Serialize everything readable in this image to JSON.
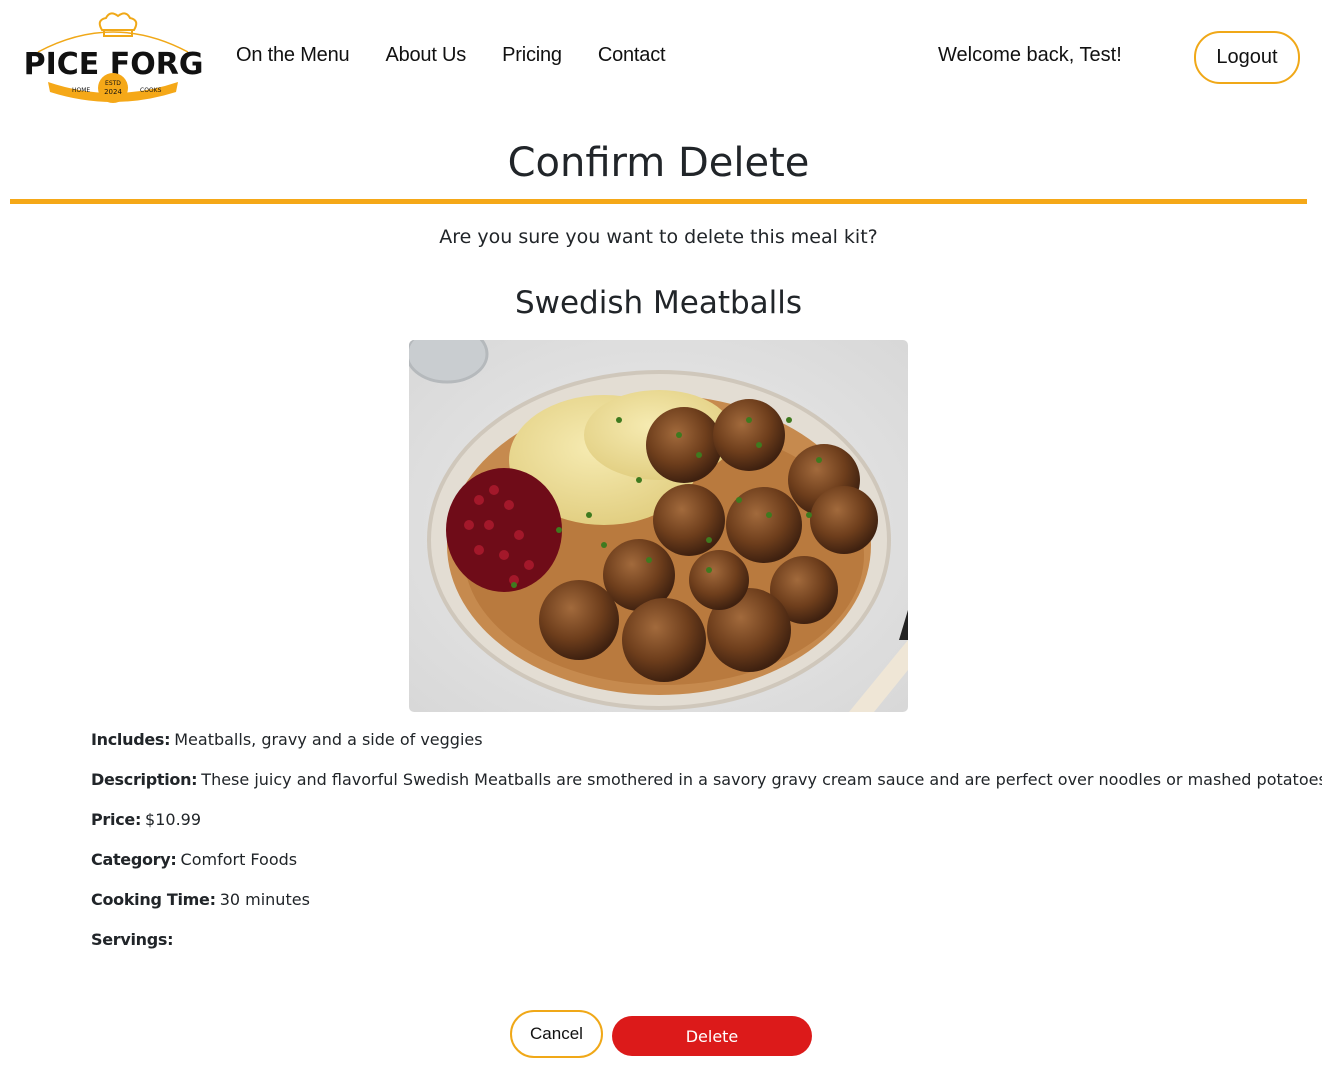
{
  "colors": {
    "accent": "#f5a818",
    "danger": "#dc1a1a",
    "text": "#212529"
  },
  "header": {
    "logo": {
      "icon": "chef-hat-logo",
      "brand": "SPICE FORGE",
      "left_tag": "HOME",
      "right_tag": "COOKS",
      "estd": "ESTD",
      "year": "2024"
    },
    "nav": [
      "On the Menu",
      "About Us",
      "Pricing",
      "Contact"
    ],
    "welcome": "Welcome back, Test!",
    "logout_label": "Logout"
  },
  "main": {
    "title": "Confirm Delete",
    "prompt": "Are you sure you want to delete this meal kit?",
    "meal_kit": {
      "name": "Swedish Meatballs",
      "image": "swedish-meatballs-photo",
      "includes_label": "Includes:",
      "includes": "Meatballs, gravy and a side of veggies",
      "description_label": "Description:",
      "description": "These juicy and flavorful Swedish Meatballs are smothered in a savory gravy cream sauce and are perfect over noodles or mashed potatoes.",
      "price_label": "Price:",
      "price": "$10.99",
      "category_label": "Category:",
      "category": "Comfort Foods",
      "cooking_time_label": "Cooking Time:",
      "cooking_time": "30 minutes",
      "servings_label": "Servings:",
      "servings": ""
    },
    "cancel_label": "Cancel",
    "delete_label": "Delete"
  }
}
